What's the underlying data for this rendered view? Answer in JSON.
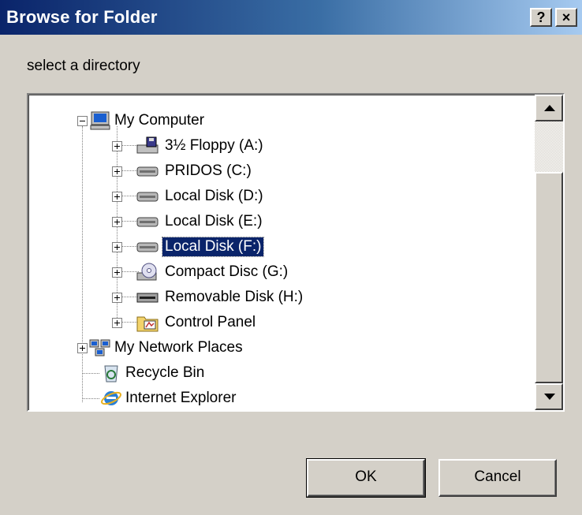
{
  "window": {
    "title": "Browse for Folder",
    "help_label": "?",
    "close_label": "×"
  },
  "prompt": "select a directory",
  "tree": {
    "root": {
      "label": "My Computer",
      "icon": "computer-icon",
      "expanded": true
    },
    "drives": [
      {
        "label": "3½ Floppy (A:)",
        "icon": "floppy-drive-icon"
      },
      {
        "label": "PRIDOS (C:)",
        "icon": "hard-drive-icon"
      },
      {
        "label": "Local Disk (D:)",
        "icon": "hard-drive-icon"
      },
      {
        "label": "Local Disk (E:)",
        "icon": "hard-drive-icon"
      },
      {
        "label": "Local Disk (F:)",
        "icon": "hard-drive-icon",
        "selected": true
      },
      {
        "label": "Compact Disc (G:)",
        "icon": "cd-drive-icon"
      },
      {
        "label": "Removable Disk (H:)",
        "icon": "removable-drive-icon"
      },
      {
        "label": "Control Panel",
        "icon": "control-panel-icon"
      }
    ],
    "others": [
      {
        "label": "My Network Places",
        "icon": "network-places-icon"
      },
      {
        "label": "Recycle Bin",
        "icon": "recycle-bin-icon"
      },
      {
        "label": "Internet Explorer",
        "icon": "internet-explorer-icon"
      }
    ]
  },
  "buttons": {
    "ok": "OK",
    "cancel": "Cancel"
  },
  "colors": {
    "selection": "#0a246a",
    "title_start": "#0a246a",
    "face": "#d4d0c8"
  }
}
